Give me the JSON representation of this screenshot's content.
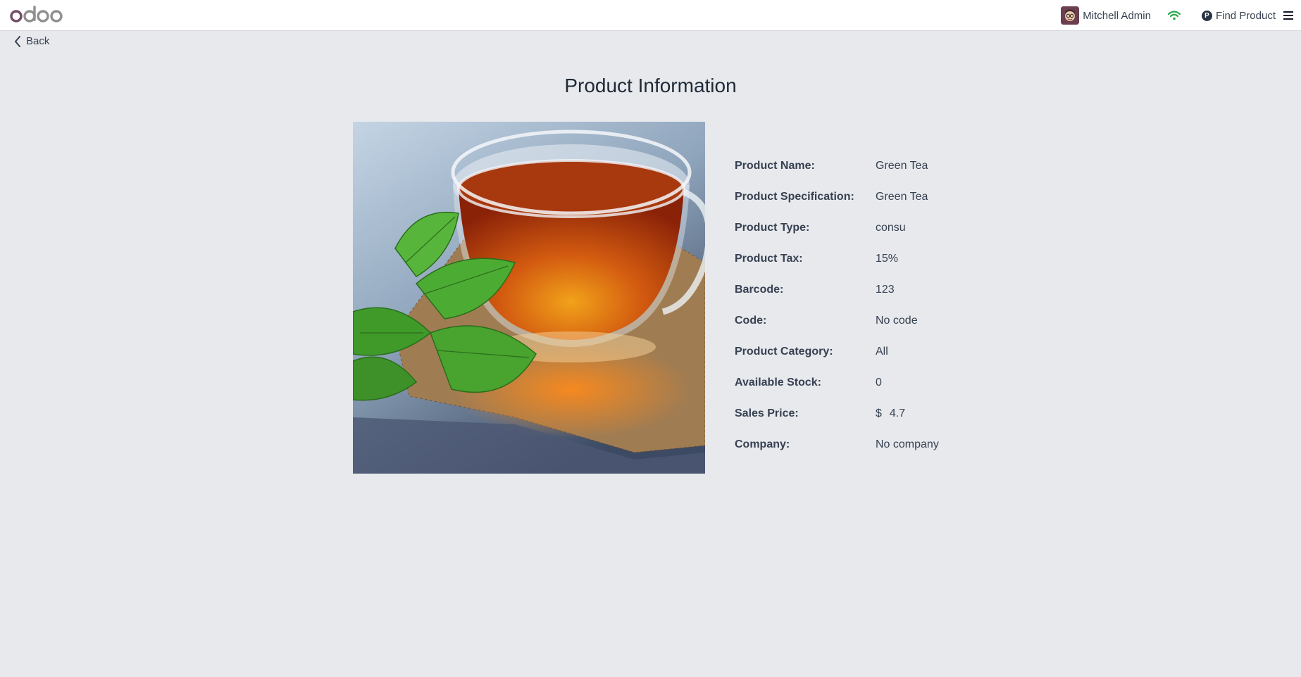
{
  "navbar": {
    "logo_text": "odoo",
    "user_name": "Mitchell Admin",
    "find_product_label": "Find Product",
    "find_product_icon_letter": "P",
    "icons": [
      "user-avatar",
      "wifi-icon",
      "find-product-icon",
      "menu-icon"
    ]
  },
  "back_label": "Back",
  "page_title": "Product Information",
  "product_image_alt": "Green Tea",
  "fields": {
    "name": {
      "label": "Product Name:",
      "value": "Green Tea"
    },
    "specification": {
      "label": "Product Specification:",
      "value": "Green Tea"
    },
    "type": {
      "label": "Product Type:",
      "value": "consu"
    },
    "tax": {
      "label": "Product Tax:",
      "value": "15%"
    },
    "barcode": {
      "label": "Barcode:",
      "value": "123"
    },
    "code": {
      "label": "Code:",
      "value": "No code"
    },
    "category": {
      "label": "Product Category:",
      "value": "All"
    },
    "stock": {
      "label": "Available Stock:",
      "value": "0"
    },
    "price": {
      "label": "Sales Price:",
      "currency": "$",
      "value": "4.7"
    },
    "company": {
      "label": "Company:",
      "value": "No company"
    }
  },
  "colors": {
    "background": "#e7e9ed",
    "logo_purple": "#714b67",
    "logo_gray": "#8f8f8f",
    "wifi_green": "#28a745"
  }
}
